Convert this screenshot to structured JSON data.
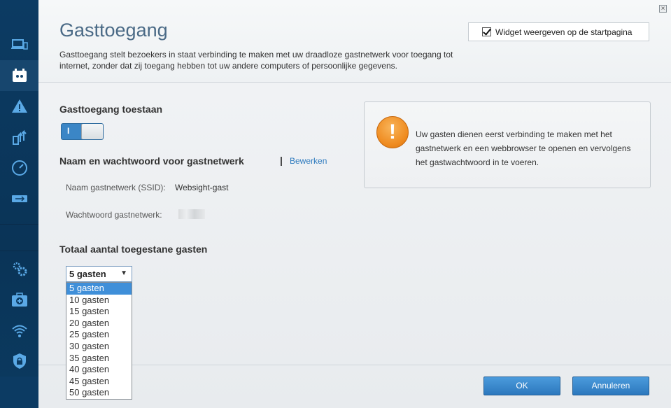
{
  "header": {
    "title": "Gasttoegang",
    "description": "Gasttoegang stelt bezoekers in staat verbinding te maken met uw draadloze gastnetwerk voor toegang tot internet, zonder dat zij toegang hebben tot uw andere computers of persoonlijke gegevens.",
    "widget_label": "Widget weergeven op de startpagina",
    "widget_checked": true,
    "close_label": "×"
  },
  "guest_access": {
    "title": "Gasttoegang toestaan",
    "toggle_label": "I",
    "toggle_on": true
  },
  "network": {
    "title": "Naam en wachtwoord voor gastnetwerk",
    "separator": "|",
    "edit_link": "Bewerken",
    "ssid_label": "Naam gastnetwerk (SSID):",
    "ssid_value": "Websight-gast",
    "password_label": "Wachtwoord gastnetwerk:"
  },
  "info": {
    "icon_glyph": "!",
    "text": "Uw gasten dienen eerst verbinding te maken met het gastnetwerk en een webbrowser te openen en vervolgens het gastwachtwoord in te voeren."
  },
  "guests": {
    "title": "Totaal aantal toegestane gasten",
    "selected": "5 gasten",
    "arrow": "▼",
    "options": [
      "5 gasten",
      "10 gasten",
      "15 gasten",
      "20 gasten",
      "25 gasten",
      "30 gasten",
      "35 gasten",
      "40 gasten",
      "45 gasten",
      "50 gasten"
    ]
  },
  "footer": {
    "ok_label": "OK",
    "cancel_label": "Annuleren"
  },
  "colors": {
    "sidebar_bg": "#0c3b63",
    "accent": "#2f7bbf",
    "button_blue": "#2c78bd",
    "warning_orange": "#ef8b1f",
    "icon_blue": "#5aa9e6"
  }
}
